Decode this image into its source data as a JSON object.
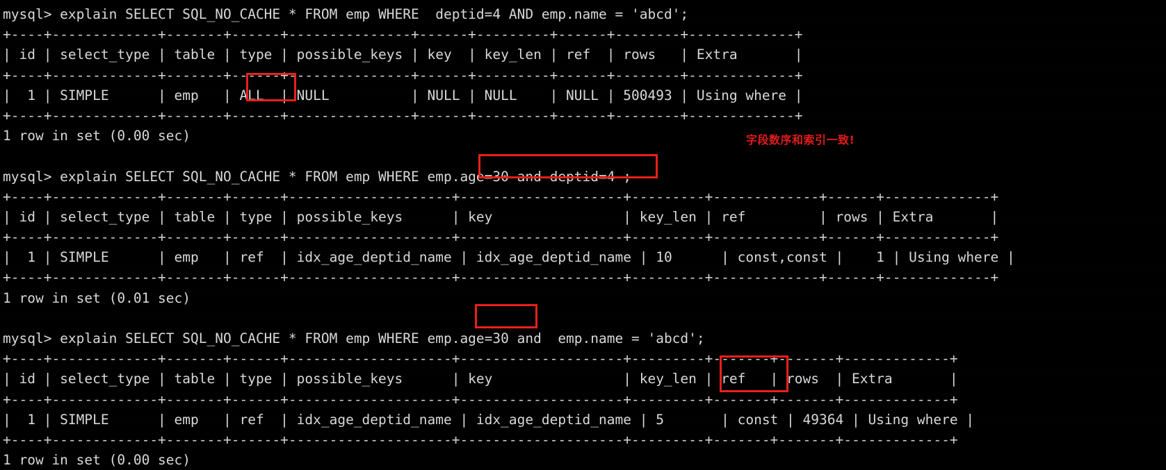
{
  "terminal": {
    "prompt": "mysql>",
    "colors": {
      "background": "#000000",
      "foreground": "#d8d8d8",
      "highlight_box": "#e8201a",
      "annotation_text": "#e01b1b"
    },
    "blocks": [
      {
        "id": "block-1",
        "command": "mysql> explain SELECT SQL_NO_CACHE * FROM emp WHERE  deptid=4 AND emp.name = 'abcd';",
        "separator_top": "+----+-------------+-------+------+---------------+------+---------+------+--------+-------------+",
        "header_row": "| id | select_type | table | type | possible_keys | key  | key_len | ref  | rows   | Extra       |",
        "separator_mid": "+----+-------------+-------+------+---------------+------+---------+------+--------+-------------+",
        "data_row": "|  1 | SIMPLE      | emp   | ALL  | NULL          | NULL | NULL    | NULL | 500493 | Using where |",
        "separator_bottom": "+----+-------------+-------+------+---------------+------+---------+------+--------+-------------+",
        "result_status": "1 row in set (0.00 sec)",
        "columns": [
          "id",
          "select_type",
          "table",
          "type",
          "possible_keys",
          "key",
          "key_len",
          "ref",
          "rows",
          "Extra"
        ],
        "values": [
          "1",
          "SIMPLE",
          "emp",
          "ALL",
          "NULL",
          "NULL",
          "NULL",
          "NULL",
          "500493",
          "Using where"
        ]
      },
      {
        "id": "block-2",
        "command": "mysql> explain SELECT SQL_NO_CACHE * FROM emp WHERE emp.age=30 and deptid=4 ;",
        "separator_top": "+----+-------------+-------+------+--------------------+--------------------+---------+-------------+------+-------------+",
        "header_row": "| id | select_type | table | type | possible_keys      | key                | key_len | ref         | rows | Extra       |",
        "separator_mid": "+----+-------------+-------+------+--------------------+--------------------+---------+-------------+------+-------------+",
        "data_row": "|  1 | SIMPLE      | emp   | ref  | idx_age_deptid_name | idx_age_deptid_name | 10      | const,const |    1 | Using where |",
        "separator_bottom": "+----+-------------+-------+------+--------------------+--------------------+---------+-------------+------+-------------+",
        "result_status": "1 row in set (0.01 sec)",
        "columns": [
          "id",
          "select_type",
          "table",
          "type",
          "possible_keys",
          "key",
          "key_len",
          "ref",
          "rows",
          "Extra"
        ],
        "values": [
          "1",
          "SIMPLE",
          "emp",
          "ref",
          "idx_age_deptid_name",
          "idx_age_deptid_name",
          "10",
          "const,const",
          "1",
          "Using where"
        ]
      },
      {
        "id": "block-3",
        "command": "mysql> explain SELECT SQL_NO_CACHE * FROM emp WHERE emp.age=30 and  emp.name = 'abcd';",
        "separator_top": "+----+-------------+-------+------+--------------------+--------------------+---------+-------+-------+-------------+",
        "header_row": "| id | select_type | table | type | possible_keys      | key                | key_len | ref   | rows  | Extra       |",
        "separator_mid": "+----+-------------+-------+------+--------------------+--------------------+---------+-------+-------+-------------+",
        "data_row": "|  1 | SIMPLE      | emp   | ref  | idx_age_deptid_name | idx_age_deptid_name | 5       | const | 49364 | Using where |",
        "separator_bottom": "+----+-------------+-------+------+--------------------+--------------------+---------+-------+-------+-------------+",
        "result_status": "1 row in set (0.00 sec)",
        "columns": [
          "id",
          "select_type",
          "table",
          "type",
          "possible_keys",
          "key",
          "key_len",
          "ref",
          "rows",
          "Extra"
        ],
        "values": [
          "1",
          "SIMPLE",
          "emp",
          "ref",
          "idx_age_deptid_name",
          "idx_age_deptid_name",
          "5",
          "const",
          "49364",
          "Using where"
        ]
      }
    ],
    "annotations": [
      {
        "id": "note-field-order",
        "text": "字段数序和索引一致!",
        "color": "#e01b1b"
      }
    ],
    "highlights": [
      {
        "id": "highlight-type-all",
        "target": "ALL"
      },
      {
        "id": "highlight-where-age-deptid",
        "target": "emp.age=30 and deptid=4 ;"
      },
      {
        "id": "highlight-where-age",
        "target": "emp.age=30"
      },
      {
        "id": "highlight-keylen-5",
        "target": "5"
      }
    ]
  }
}
